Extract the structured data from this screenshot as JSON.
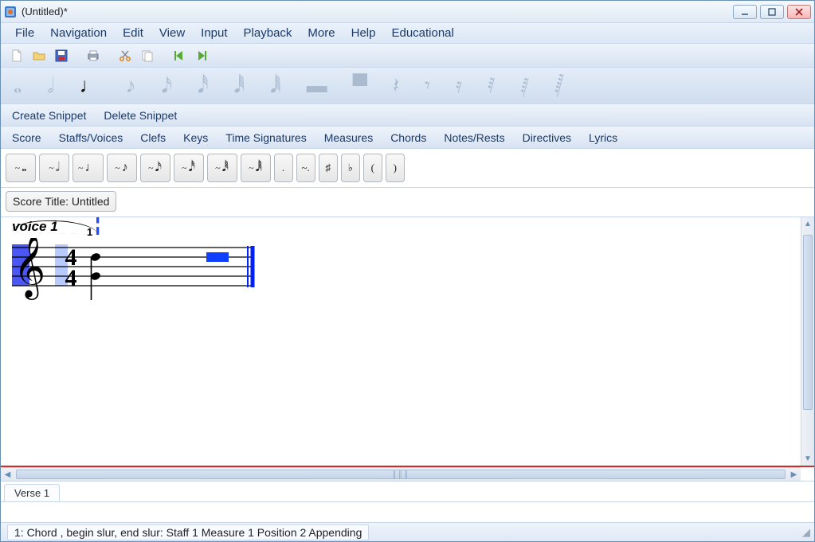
{
  "title": "(Untitled)*",
  "menu": [
    "File",
    "Navigation",
    "Edit",
    "View",
    "Input",
    "Playback",
    "More",
    "Help",
    "Educational"
  ],
  "snippet_bar": [
    "Create Snippet",
    "Delete Snippet"
  ],
  "object_bar": [
    "Score",
    "Staffs/Voices",
    "Clefs",
    "Keys",
    "Time Signatures",
    "Measures",
    "Chords",
    "Notes/Rests",
    "Directives",
    "Lyrics"
  ],
  "entry_buttons": {
    "b1": "𝅝",
    "b2": "𝅗𝅥",
    "b3": "♩",
    "b4": "♪",
    "b5": "𝅘𝅥𝅯",
    "b6": "𝅘𝅥𝅰",
    "b7": "𝅘𝅥𝅱",
    "b8": "𝅘𝅥𝅲",
    "dot": ".",
    "tilde2": "~.",
    "sharp": "♯",
    "flat": "♭",
    "lparen": "(",
    "rparen": ")"
  },
  "score_title": "Score Title: Untitled",
  "voice_label": "voice 1",
  "measure_number": "1",
  "verse_tab": "Verse 1",
  "status": "1: Chord , begin slur, end slur:  Staff 1 Measure 1 Position 2 Appending",
  "time_sig": {
    "num": "4",
    "den": "4"
  }
}
